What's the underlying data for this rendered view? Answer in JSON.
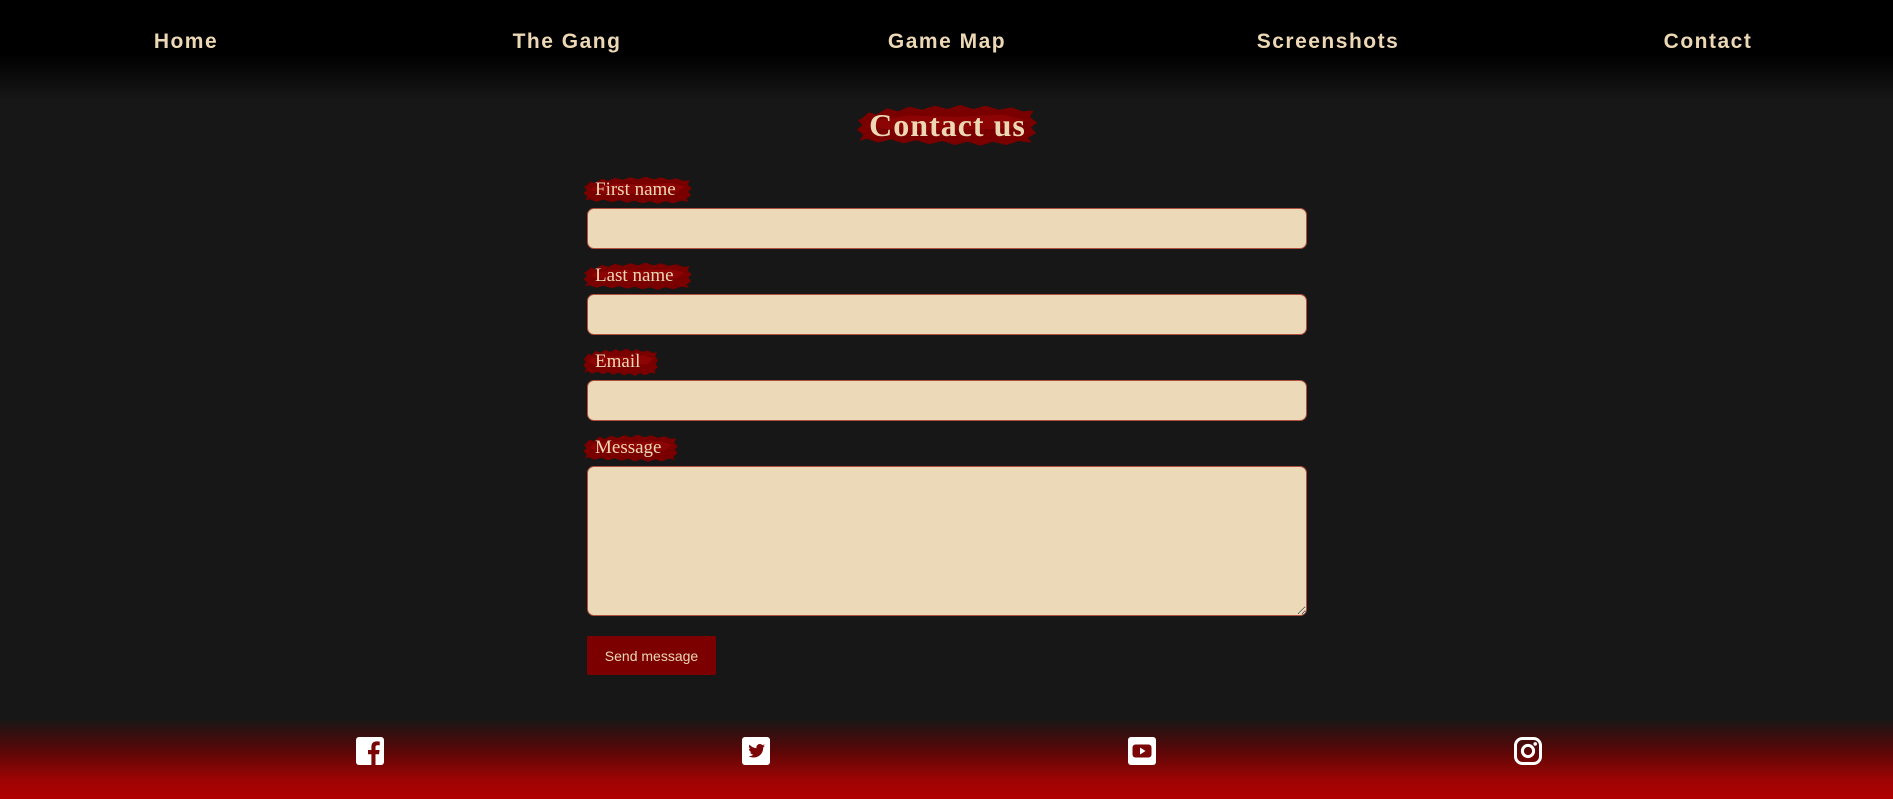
{
  "nav": {
    "items": [
      {
        "label": "Home"
      },
      {
        "label": "The Gang"
      },
      {
        "label": "Game Map"
      },
      {
        "label": "Screenshots"
      },
      {
        "label": "Contact"
      }
    ]
  },
  "page": {
    "title": "Contact us"
  },
  "form": {
    "first_name_label": "First name",
    "first_name_value": "",
    "last_name_label": "Last name",
    "last_name_value": "",
    "email_label": "Email",
    "email_value": "",
    "message_label": "Message",
    "message_value": "",
    "submit_label": "Send message"
  },
  "footer": {
    "social": [
      {
        "icon": "facebook-icon"
      },
      {
        "icon": "twitter-icon"
      },
      {
        "icon": "youtube-icon"
      },
      {
        "icon": "instagram-icon"
      }
    ]
  },
  "colors": {
    "background": "#171717",
    "accent_red": "#7d0000",
    "cream_text": "#ecd8b4",
    "field_fill": "#ebd9b8",
    "footer_red": "#b00000"
  }
}
